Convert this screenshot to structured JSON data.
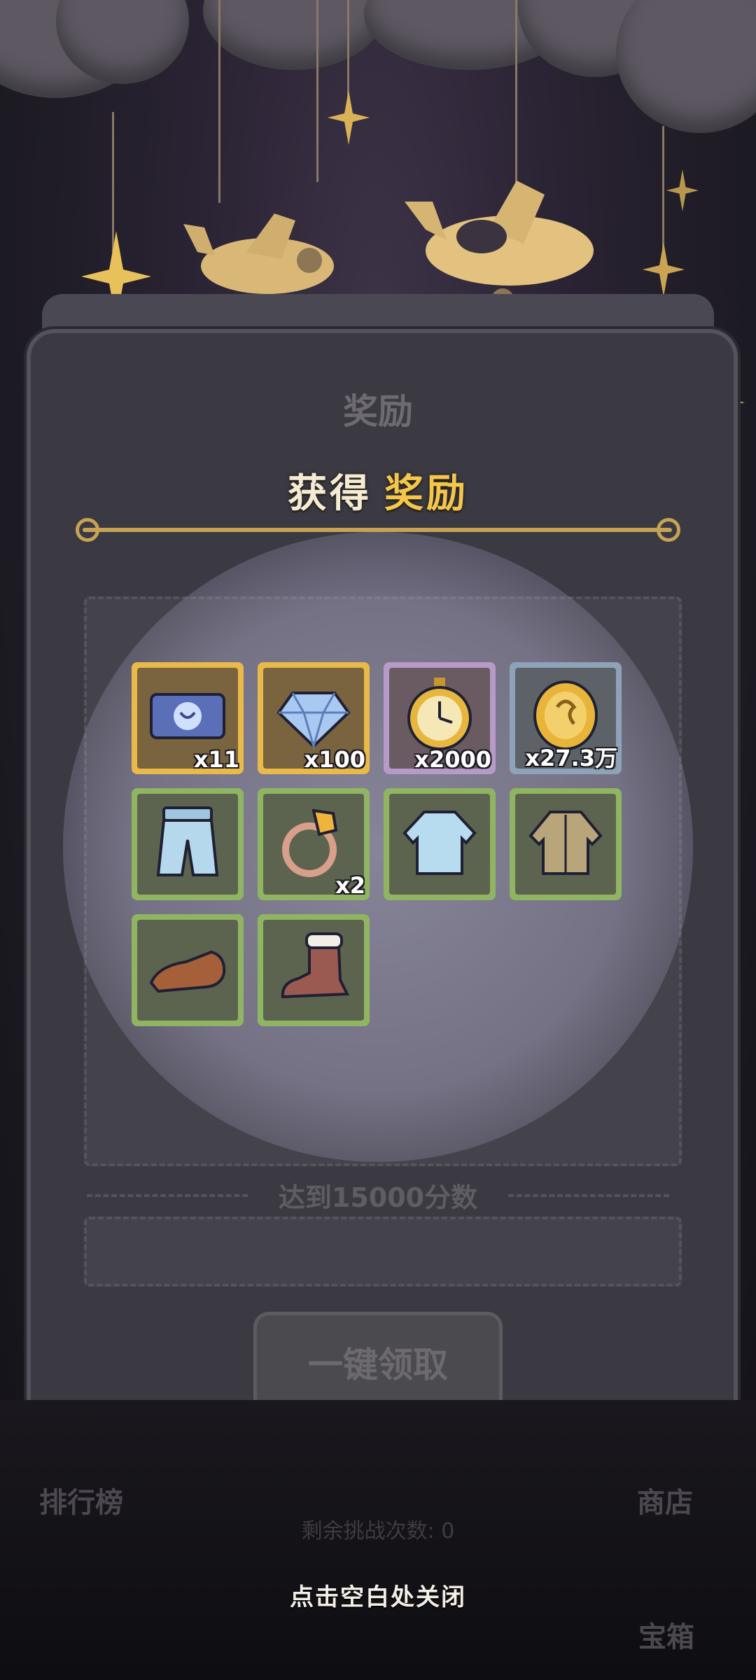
{
  "background": {
    "panel_title": "奖励",
    "score_target_label": "达到15000分数",
    "claim_all_button": "一键领取",
    "leaderboard_label": "排行榜",
    "shop_label": "商店",
    "chest_label": "宝箱",
    "remaining_challenges": "剩余挑战次数: 0"
  },
  "reward_popup": {
    "title_part1": "获得",
    "title_part2": "奖励",
    "items": [
      {
        "icon": "ticket-icon",
        "qty": "x11",
        "rarity": "gold"
      },
      {
        "icon": "diamond-icon",
        "qty": "x100",
        "rarity": "gold"
      },
      {
        "icon": "stopwatch-icon",
        "qty": "x2000",
        "rarity": "purple"
      },
      {
        "icon": "coin-icon",
        "qty": "x27.3万",
        "rarity": "blue"
      },
      {
        "icon": "pants-icon",
        "qty": "",
        "rarity": "green"
      },
      {
        "icon": "ring-icon",
        "qty": "x2",
        "rarity": "green"
      },
      {
        "icon": "sweater-icon",
        "qty": "",
        "rarity": "green"
      },
      {
        "icon": "jacket-icon",
        "qty": "",
        "rarity": "green"
      },
      {
        "icon": "shoe-icon",
        "qty": "",
        "rarity": "green"
      },
      {
        "icon": "boot-icon",
        "qty": "",
        "rarity": "green"
      }
    ],
    "close_hint": "点击空白处关闭"
  },
  "colors": {
    "gold_frame": "#e9b94a",
    "purple_frame": "#b79ac7",
    "blue_frame": "#8ea3b9",
    "green_frame": "#8fb563",
    "title_accent": "#f4c64a"
  }
}
